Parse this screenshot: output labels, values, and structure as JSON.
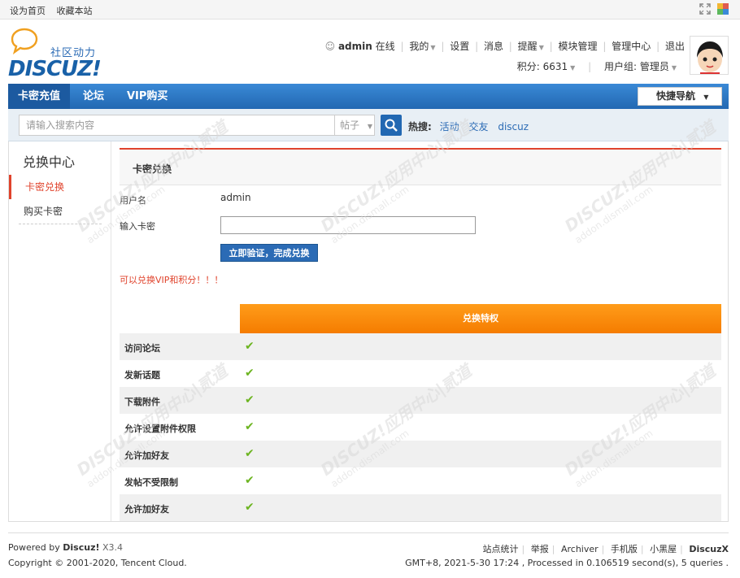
{
  "topbar": {
    "set_home": "设为首页",
    "bookmark": "收藏本站"
  },
  "logo": {
    "tagline": "社区动力",
    "brand": "DISCUZ!"
  },
  "user": {
    "name": "admin",
    "status": "在线",
    "links": [
      "我的",
      "设置",
      "消息",
      "提醒",
      "模块管理",
      "管理中心",
      "退出"
    ],
    "credits": "积分: 6631",
    "group": "用户组: 管理员"
  },
  "nav": {
    "items": [
      "卡密充值",
      "论坛",
      "VIP购买"
    ],
    "quick_nav": "快捷导航"
  },
  "search": {
    "placeholder": "请输入搜索内容",
    "type": "帖子",
    "hot_label": "热搜:",
    "hot_keywords": [
      "活动",
      "交友",
      "discuz"
    ]
  },
  "sidebar": {
    "title": "兑换中心",
    "items": [
      "卡密兑换",
      "购买卡密"
    ]
  },
  "main": {
    "tab_title": "卡密兑换",
    "username_label": "用户名",
    "username_value": "admin",
    "card_label": "输入卡密",
    "card_value": "",
    "verify_button": "立即验证，完成兑换",
    "notice": "可以兑换VIP和积分！！！",
    "privilege_header": "兑换特权",
    "privileges": [
      "访问论坛",
      "发新话题",
      "下载附件",
      "允许设置附件权限",
      "允许加好友",
      "发帖不受限制",
      "允许加好友"
    ]
  },
  "footer": {
    "powered_prefix": "Powered by",
    "powered_brand": "Discuz!",
    "version": "X3.4",
    "copyright": "Copyright © 2001-2020, Tencent Cloud.",
    "links": [
      "站点统计",
      "举报",
      "Archiver",
      "手机版",
      "小黑屋"
    ],
    "brand": "DiscuzX",
    "stats": "GMT+8, 2021-5-30 17:24 , Processed in 0.106519 second(s), 5 queries ."
  },
  "watermark": {
    "brand": "DISCUZ!应用中心|贰道",
    "domain": "addon.dismall.com"
  },
  "colors": {
    "primary": "#2b6bb5",
    "accent": "#e0432c",
    "orange": "#f57c00",
    "check": "#6cb420"
  }
}
